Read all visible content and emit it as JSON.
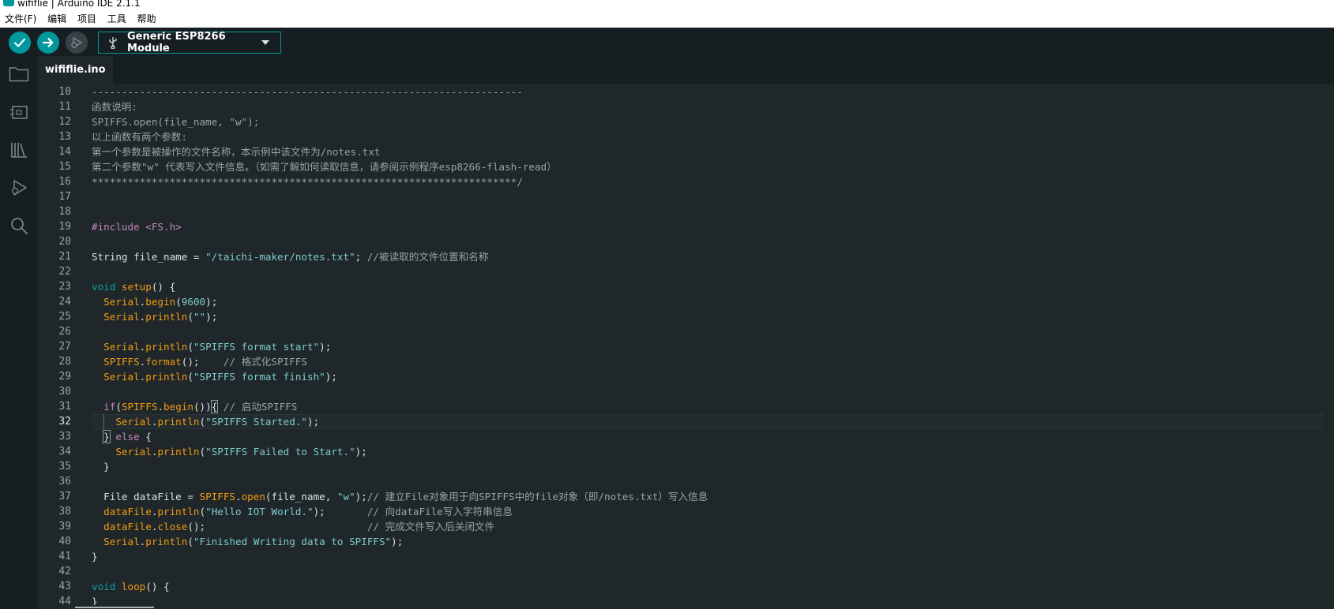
{
  "window": {
    "title": "wififlie | Arduino IDE 2.1.1"
  },
  "menu": [
    "文件(F)",
    "编辑",
    "项目",
    "工具",
    "帮助"
  ],
  "toolbar": {
    "verify_icon": "check-icon",
    "upload_icon": "arrow-right-icon",
    "debug_icon": "debug-icon",
    "board": "Generic ESP8266 Module"
  },
  "sidebar": [
    "folder-icon",
    "board-icon",
    "library-icon",
    "debug-icon",
    "search-icon"
  ],
  "tab": {
    "name": "wififlie.ino"
  },
  "editor": {
    "current_line": 32,
    "line_numbers": [
      "10",
      "11",
      "12",
      "13",
      "14",
      "15",
      "16",
      "17",
      "18",
      "19",
      "20",
      "21",
      "22",
      "23",
      "24",
      "25",
      "26",
      "27",
      "28",
      "29",
      "30",
      "31",
      "32",
      "33",
      "34",
      "35",
      "36",
      "37",
      "38",
      "39",
      "40",
      "41",
      "42",
      "43",
      "44"
    ],
    "lines": {
      "l10": "------------------------------------------------------------------------",
      "l11": "函数说明:",
      "l12": "SPIFFS.open(file_name, \"w\");",
      "l13": "以上函数有两个参数:",
      "l14": "第一个参数是被操作的文件名称，本示例中该文件为/notes.txt",
      "l15": "第二个参数\"w\" 代表写入文件信息。（如需了解如何读取信息，请参阅示例程序esp8266-flash-read）",
      "l16": "***********************************************************************/",
      "l19a": "#include ",
      "l19b": "<FS.h>",
      "l21a": "String file_name = ",
      "l21b": "\"/taichi-maker/notes.txt\"",
      "l21c": "; ",
      "l21d": "//被读取的文件位置和名称",
      "l23a": "void ",
      "l23b": "setup",
      "l23c": "() {",
      "l24a": "  ",
      "l24b": "Serial",
      "l24c": ".",
      "l24d": "begin",
      "l24e": "(",
      "l24f": "9600",
      "l24g": ");",
      "l25a": "  ",
      "l25b": "Serial",
      "l25c": ".",
      "l25d": "println",
      "l25e": "(",
      "l25f": "\"\"",
      "l25g": ");",
      "l27a": "  ",
      "l27b": "Serial",
      "l27c": ".",
      "l27d": "println",
      "l27e": "(",
      "l27f": "\"SPIFFS format start\"",
      "l27g": ");",
      "l28a": "  ",
      "l28b": "SPIFFS",
      "l28c": ".",
      "l28d": "format",
      "l28e": "();    ",
      "l28f": "// 格式化SPIFFS",
      "l29a": "  ",
      "l29b": "Serial",
      "l29c": ".",
      "l29d": "println",
      "l29e": "(",
      "l29f": "\"SPIFFS format finish\"",
      "l29g": ");",
      "l31a": "  ",
      "l31b": "if",
      "l31c": "(",
      "l31d": "SPIFFS",
      "l31e": ".",
      "l31f": "begin",
      "l31g": "())",
      "l31h": "{",
      "l31i": " ",
      "l31j": "// 启动SPIFFS",
      "l32a": "    ",
      "l32b": "Serial",
      "l32c": ".",
      "l32d": "println",
      "l32e": "(",
      "l32f": "\"SPIFFS Started.\"",
      "l32g": ");",
      "l33a": "  ",
      "l33b": "}",
      "l33c": " ",
      "l33d": "else",
      "l33e": " {",
      "l34a": "    ",
      "l34b": "Serial",
      "l34c": ".",
      "l34d": "println",
      "l34e": "(",
      "l34f": "\"SPIFFS Failed to Start.\"",
      "l34g": ");",
      "l35": "  }",
      "l37a": "  File dataFile = ",
      "l37b": "SPIFFS",
      "l37c": ".",
      "l37d": "open",
      "l37e": "(file_name, ",
      "l37f": "\"w\"",
      "l37g": ");",
      "l37h": "// 建立File对象用于向SPIFFS中的file对象（即/notes.txt）写入信息",
      "l38a": "  ",
      "l38b": "dataFile",
      "l38c": ".",
      "l38d": "println",
      "l38e": "(",
      "l38f": "\"Hello IOT World.\"",
      "l38g": ");       ",
      "l38h": "// 向dataFile写入字符串信息",
      "l39a": "  ",
      "l39b": "dataFile",
      "l39c": ".",
      "l39d": "close",
      "l39e": "();                           ",
      "l39f": "// 完成文件写入后关闭文件",
      "l40a": "  ",
      "l40b": "Serial",
      "l40c": ".",
      "l40d": "println",
      "l40e": "(",
      "l40f": "\"Finished Writing data to SPIFFS\"",
      "l40g": ");",
      "l41": "}",
      "l43a": "void ",
      "l43b": "loop",
      "l43c": "() {",
      "l44": "}"
    }
  },
  "colors": {
    "accent": "#00979d",
    "background": "#1f272a",
    "toolbar": "#171e21",
    "comment": "#95a5a6",
    "keyword": "#c586c0",
    "function": "#f39c12",
    "string": "#7fcbcd"
  }
}
